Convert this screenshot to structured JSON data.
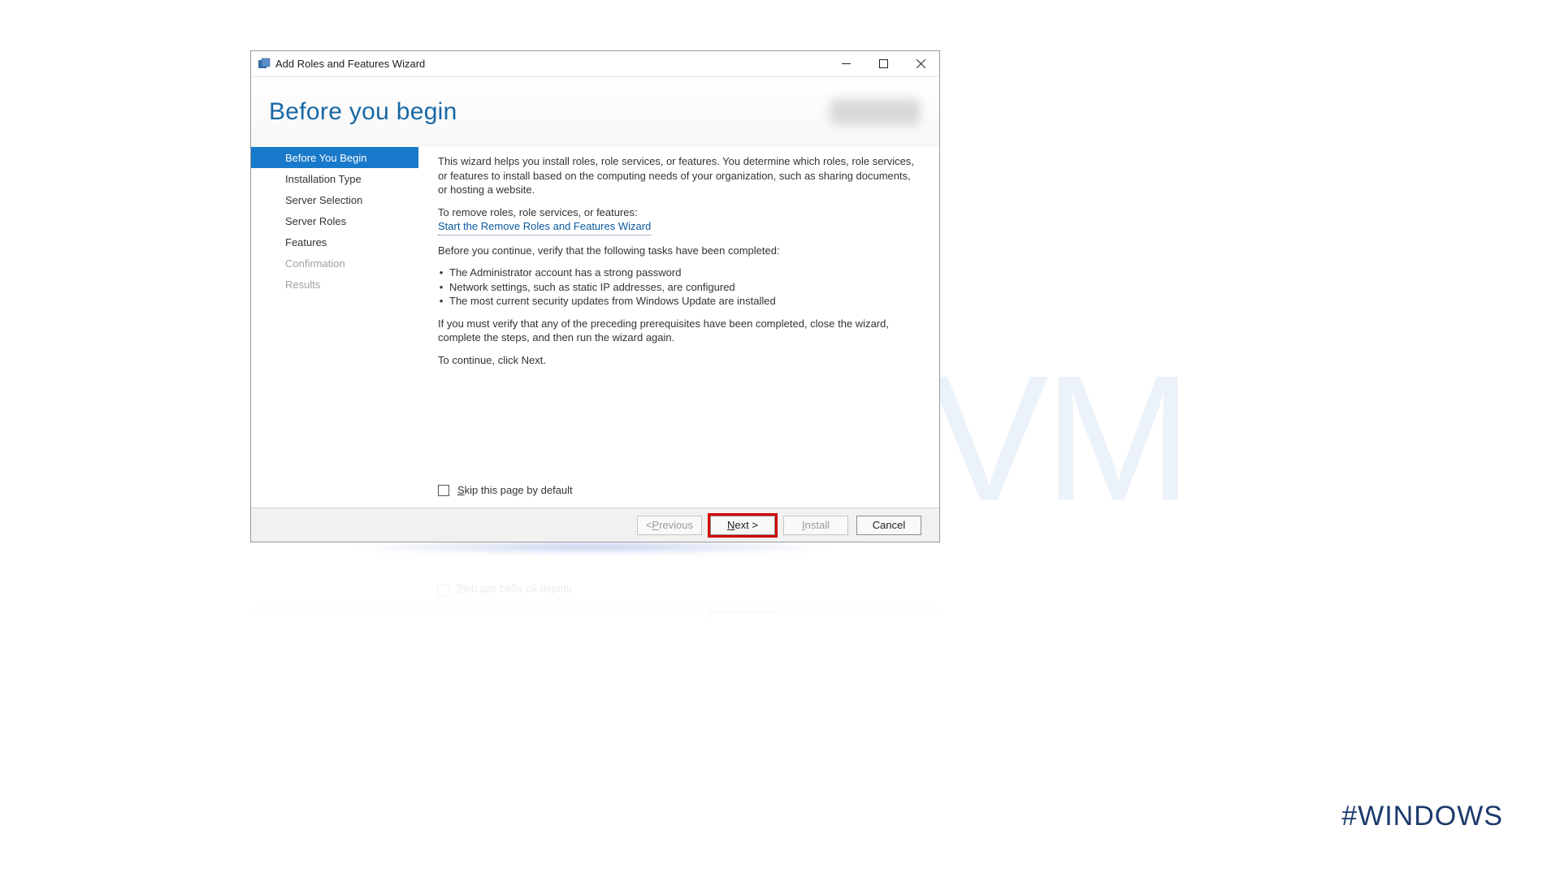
{
  "watermark": "NeuronVM",
  "hashtag": "#WINDOWS",
  "window": {
    "title": "Add Roles and Features Wizard",
    "page_title": "Before you begin"
  },
  "nav": {
    "items": [
      {
        "label": "Before You Begin",
        "state": "selected"
      },
      {
        "label": "Installation Type",
        "state": "normal"
      },
      {
        "label": "Server Selection",
        "state": "normal"
      },
      {
        "label": "Server Roles",
        "state": "normal"
      },
      {
        "label": "Features",
        "state": "normal"
      },
      {
        "label": "Confirmation",
        "state": "disabled"
      },
      {
        "label": "Results",
        "state": "disabled"
      }
    ]
  },
  "content": {
    "intro": "This wizard helps you install roles, role services, or features. You determine which roles, role services, or features to install based on the computing needs of your organization, such as sharing documents, or hosting a website.",
    "remove_header": "To remove roles, role services, or features:",
    "remove_link": "Start the Remove Roles and Features Wizard",
    "verify_header": "Before you continue, verify that the following tasks have been completed:",
    "bullets": [
      "The Administrator account has a strong password",
      "Network settings, such as static IP addresses, are configured",
      "The most current security updates from Windows Update are installed"
    ],
    "after_bullets": "If you must verify that any of the preceding prerequisites have been completed, close the wizard, complete the steps, and then run the wizard again.",
    "continue": "To continue, click Next.",
    "skip_pre": "S",
    "skip_rest": "kip this page by default"
  },
  "footer": {
    "previous_pre": "< ",
    "previous_u": "P",
    "previous_post": "revious",
    "next_u": "N",
    "next_post": "ext >",
    "install_u": "I",
    "install_post": "nstall",
    "cancel": "Cancel"
  }
}
